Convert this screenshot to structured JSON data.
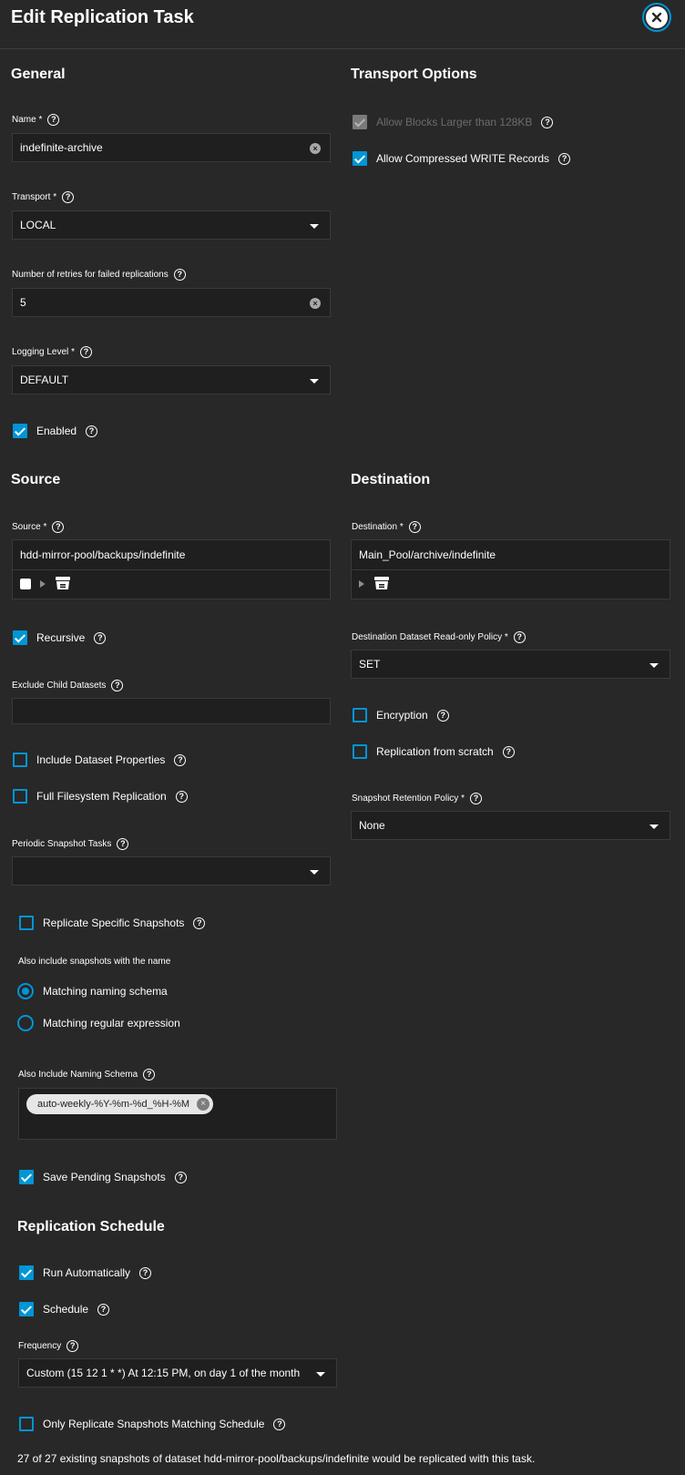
{
  "header": {
    "title": "Edit Replication Task"
  },
  "general": {
    "heading": "General",
    "name": {
      "label": "Name",
      "required": "*",
      "value": "indefinite-archive"
    },
    "transport": {
      "label": "Transport",
      "required": "*",
      "value": "LOCAL"
    },
    "retries": {
      "label": "Number of retries for failed replications",
      "value": "5"
    },
    "logging": {
      "label": "Logging Level",
      "required": "*",
      "value": "DEFAULT"
    },
    "enabled": {
      "label": "Enabled",
      "checked": true
    }
  },
  "transport_options": {
    "heading": "Transport Options",
    "large_blocks": {
      "label": "Allow Blocks Larger than 128KB",
      "checked": true,
      "disabled": true
    },
    "compressed": {
      "label": "Allow Compressed WRITE Records",
      "checked": true
    }
  },
  "source": {
    "heading": "Source",
    "source_field": {
      "label": "Source",
      "required": "*",
      "value": "hdd-mirror-pool/backups/indefinite"
    },
    "recursive": {
      "label": "Recursive",
      "checked": true
    },
    "exclude": {
      "label": "Exclude Child Datasets",
      "value": ""
    },
    "include_props": {
      "label": "Include Dataset Properties",
      "checked": false
    },
    "full_fs": {
      "label": "Full Filesystem Replication",
      "checked": false
    },
    "periodic": {
      "label": "Periodic Snapshot Tasks",
      "value": ""
    },
    "replicate_specific": {
      "label": "Replicate Specific Snapshots",
      "checked": false
    },
    "also_include_label": "Also include snapshots with the name",
    "naming_schema_radio": {
      "label": "Matching naming schema",
      "selected": true
    },
    "regex_radio": {
      "label": "Matching regular expression",
      "selected": false
    },
    "naming_schema": {
      "label": "Also Include Naming Schema",
      "chip": "auto-weekly-%Y-%m-%d_%H-%M"
    },
    "save_pending": {
      "label": "Save Pending Snapshots",
      "checked": true
    }
  },
  "destination": {
    "heading": "Destination",
    "dest_field": {
      "label": "Destination",
      "required": "*",
      "value": "Main_Pool/archive/indefinite"
    },
    "readonly_policy": {
      "label": "Destination Dataset Read-only Policy",
      "required": "*",
      "value": "SET"
    },
    "encryption": {
      "label": "Encryption",
      "checked": false
    },
    "from_scratch": {
      "label": "Replication from scratch",
      "checked": false
    },
    "retention": {
      "label": "Snapshot Retention Policy",
      "required": "*",
      "value": "None"
    }
  },
  "schedule": {
    "heading": "Replication Schedule",
    "run_auto": {
      "label": "Run Automatically",
      "checked": true
    },
    "schedule_cb": {
      "label": "Schedule",
      "checked": true
    },
    "frequency": {
      "label": "Frequency",
      "value": "Custom (15 12 1 * *) At 12:15 PM, on day 1 of the month"
    },
    "only_matching": {
      "label": "Only Replicate Snapshots Matching Schedule",
      "checked": false
    }
  },
  "footer": {
    "text": "27 of 27 existing snapshots of dataset hdd-mirror-pool/backups/indefinite would be replicated with this task."
  },
  "colors": {
    "background": "#282828",
    "accent": "#0095d5",
    "field": "#1f1f1f"
  }
}
